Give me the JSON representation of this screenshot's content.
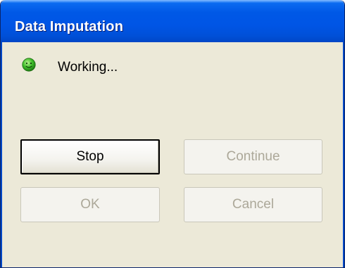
{
  "window": {
    "title": "Data Imputation"
  },
  "status": {
    "icon": "smiley-face-icon",
    "icon_color": "#3fbf2a",
    "text": "Working..."
  },
  "buttons": {
    "stop": {
      "label": "Stop",
      "enabled": true
    },
    "continue": {
      "label": "Continue",
      "enabled": false
    },
    "ok": {
      "label": "OK",
      "enabled": false
    },
    "cancel": {
      "label": "Cancel",
      "enabled": false
    }
  },
  "colors": {
    "titlebar": "#0058e6",
    "dialog_background": "#ece9d8",
    "disabled_text": "#aca899"
  }
}
